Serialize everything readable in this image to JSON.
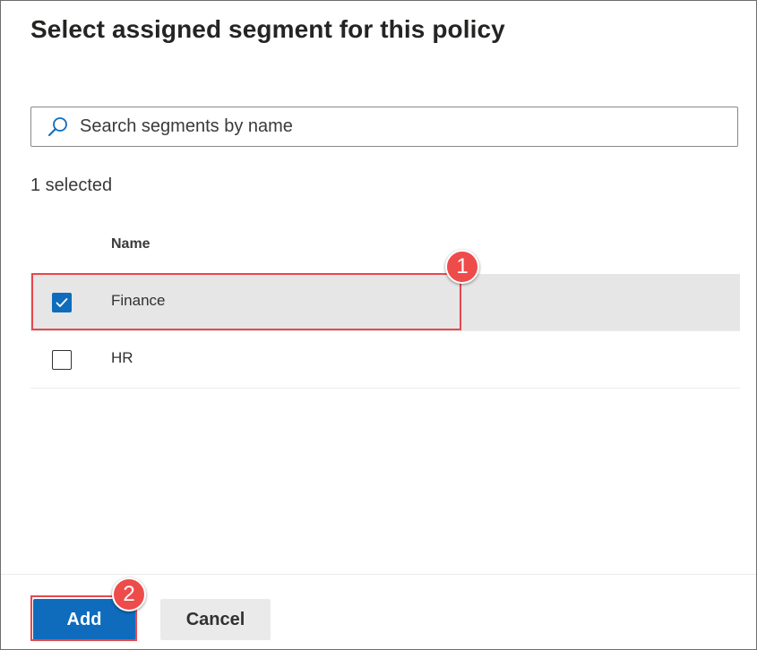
{
  "dialog": {
    "title": "Select assigned segment for this policy"
  },
  "search": {
    "placeholder": "Search segments by name",
    "value": ""
  },
  "selection": {
    "count_text": "1 selected"
  },
  "table": {
    "columns": [
      "Name"
    ],
    "rows": [
      {
        "name": "Finance",
        "checked": true
      },
      {
        "name": "HR",
        "checked": false
      }
    ]
  },
  "annotations": {
    "badge_1": "1",
    "badge_2": "2"
  },
  "footer": {
    "add_label": "Add",
    "cancel_label": "Cancel"
  },
  "colors": {
    "primary": "#0f6cbd",
    "annotation_red": "#e8474f",
    "selected_row": "#e6e6e6"
  }
}
